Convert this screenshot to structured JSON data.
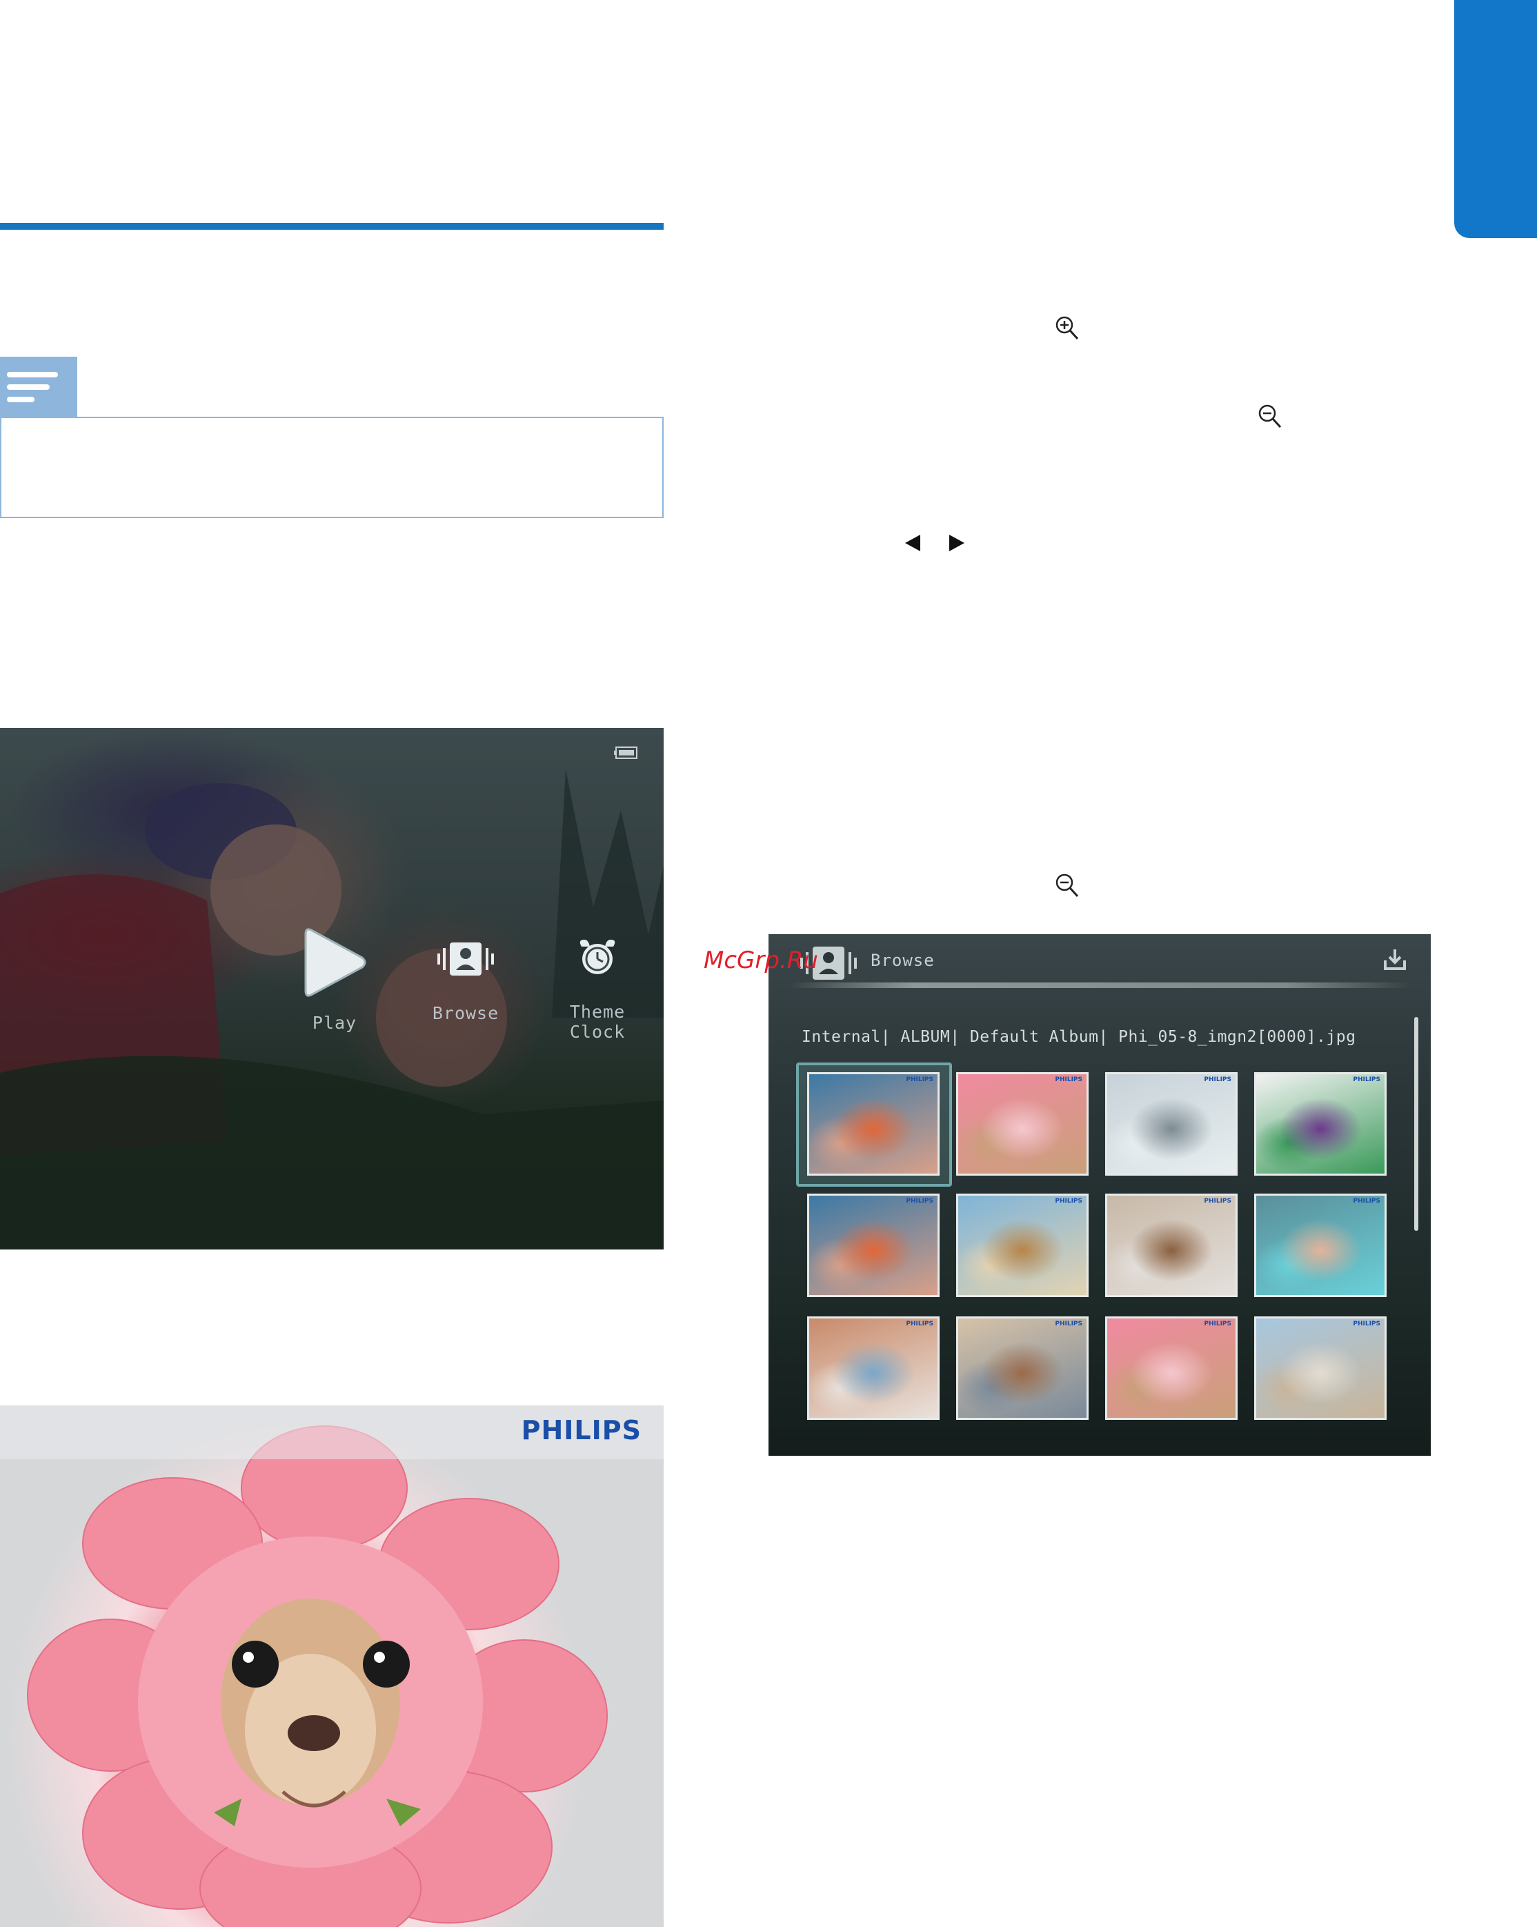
{
  "page": {
    "watermark": "McGrp.Ru"
  },
  "home_screen": {
    "items": [
      {
        "label": "Play",
        "icon": "play-icon"
      },
      {
        "label": "Browse",
        "icon": "browse-icon"
      },
      {
        "label": "Theme Clock",
        "icon": "theme-clock-icon"
      }
    ],
    "status_icon": "battery-icon"
  },
  "sample_photo": {
    "logo": "PHILIPS"
  },
  "browse_screen": {
    "title": "Browse",
    "path": "Internal| ALBUM| Default Album| Phi_05-8_imgn2[0000].jpg",
    "thumbnails": [
      {
        "name": "butterfly-hands",
        "colors": [
          "#3b79a5",
          "#e2673a",
          "#d8a08a"
        ]
      },
      {
        "name": "dog-flower",
        "colors": [
          "#f08aa0",
          "#f5c7cf",
          "#c9a07a"
        ]
      },
      {
        "name": "snow-tunnel-video",
        "colors": [
          "#c7d2d8",
          "#7e8c93",
          "#e8eef0"
        ]
      },
      {
        "name": "gift-boxes",
        "colors": [
          "#f2f2f2",
          "#6b3a8c",
          "#3a9a5a"
        ]
      },
      {
        "name": "butterfly-hands-2",
        "colors": [
          "#3b79a5",
          "#e2673a",
          "#d8a08a"
        ]
      },
      {
        "name": "stilt-house",
        "colors": [
          "#7fb4d8",
          "#b8854a",
          "#e2d3b2"
        ]
      },
      {
        "name": "photo-collage",
        "colors": [
          "#c8b9a8",
          "#8a6040",
          "#e4e0dc"
        ]
      },
      {
        "name": "girl-painted-hands",
        "colors": [
          "#5a8f9a",
          "#e4b39a",
          "#6ad0d8"
        ]
      },
      {
        "name": "woman-dog",
        "colors": [
          "#c98a6a",
          "#7aa7c9",
          "#e9e2dc"
        ]
      },
      {
        "name": "carnival-couple",
        "colors": [
          "#d6c2a8",
          "#9a6a4a",
          "#7a8a9a"
        ]
      },
      {
        "name": "dog-flower-2",
        "colors": [
          "#f08aa0",
          "#f5c7cf",
          "#c9a07a"
        ]
      },
      {
        "name": "boy-fish-beach",
        "colors": [
          "#a7c7df",
          "#e4dcd0",
          "#c9b59a"
        ]
      }
    ],
    "thumb_brand": "PHILIPS"
  },
  "icons": {
    "zoom_in": "zoom-in-icon",
    "zoom_out": "zoom-out-icon",
    "left": "left-arrow-icon",
    "right": "right-arrow-icon"
  },
  "colors": {
    "accent": "#1677c0",
    "note": "#8eb6dc",
    "tab": "#1277c8"
  }
}
